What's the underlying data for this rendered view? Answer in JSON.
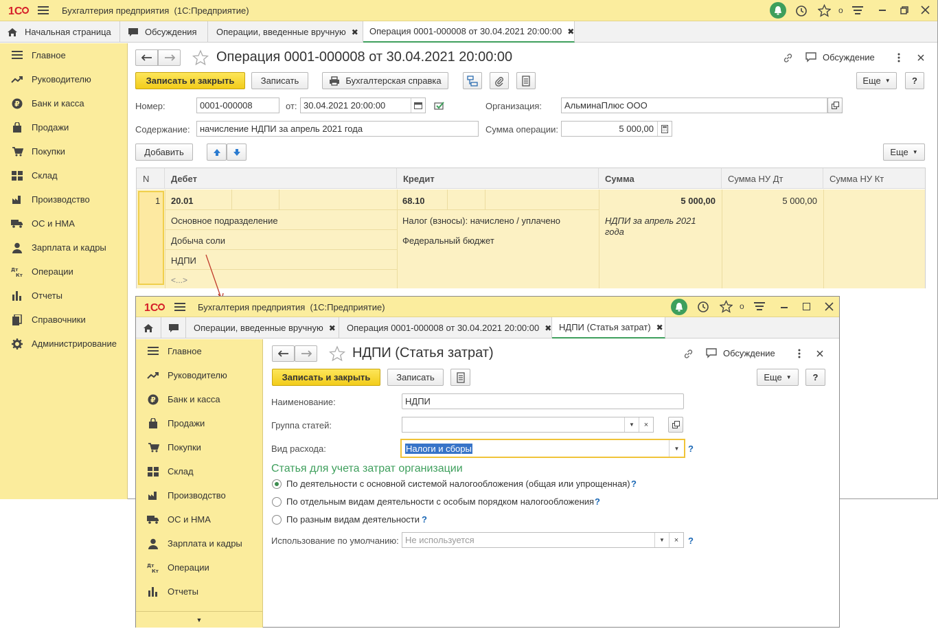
{
  "app_title": "Бухгалтерия предприятия  (1С:Предприятие)",
  "tabs": {
    "home": "Начальная страница",
    "discuss": "Обсуждения",
    "manual_ops": "Операции, введенные вручную",
    "operation": "Операция 0001-000008 от 30.04.2021 20:00:00",
    "ndpi": "НДПИ (Статья затрат)"
  },
  "sidebar": [
    {
      "label": "Главное",
      "icon": "menu-icon"
    },
    {
      "label": "Руководителю",
      "icon": "chart-trend-icon"
    },
    {
      "label": "Банк и касса",
      "icon": "ruble-icon"
    },
    {
      "label": "Продажи",
      "icon": "bag-icon"
    },
    {
      "label": "Покупки",
      "icon": "cart-icon"
    },
    {
      "label": "Склад",
      "icon": "warehouse-icon"
    },
    {
      "label": "Производство",
      "icon": "factory-icon"
    },
    {
      "label": "ОС и НМА",
      "icon": "truck-icon"
    },
    {
      "label": "Зарплата и кадры",
      "icon": "person-icon"
    },
    {
      "label": "Операции",
      "icon": "dtkt-icon"
    },
    {
      "label": "Отчеты",
      "icon": "bar-chart-icon"
    },
    {
      "label": "Справочники",
      "icon": "books-icon"
    },
    {
      "label": "Администрирование",
      "icon": "gear-icon"
    }
  ],
  "operation_form": {
    "title": "Операция 0001-000008 от 30.04.2021 20:00:00",
    "discuss": "Обсуждение",
    "save_close": "Записать и закрыть",
    "save": "Записать",
    "account_ref": "Бухгалтерская справка",
    "more": "Еще",
    "help": "?",
    "number_label": "Номер:",
    "number_value": "0001-000008",
    "date_label": "от:",
    "date_value": "30.04.2021 20:00:00",
    "org_label": "Организация:",
    "org_value": "АльминаПлюс ООО",
    "content_label": "Содержание:",
    "content_value": "начисление НДПИ за апрель 2021 года",
    "sum_label": "Сумма операции:",
    "sum_value": "5 000,00",
    "add": "Добавить",
    "more2": "Еще",
    "table": {
      "headers": {
        "n": "N",
        "debit": "Дебет",
        "credit": "Кредит",
        "sum": "Сумма",
        "sum_nu_dt": "Сумма НУ Дт",
        "sum_nu_kt": "Сумма НУ Кт"
      },
      "row": {
        "n": "1",
        "debit_account": "20.01",
        "debit_sub1": "Основное подразделение",
        "debit_sub2": "Добыча соли",
        "debit_sub3": "НДПИ",
        "debit_sub4": "<...>",
        "credit_account": "68.10",
        "credit_sub1": "Налог (взносы): начислено / уплачено",
        "credit_sub2": "Федеральный бюджет",
        "sum": "5 000,00",
        "sum_comment_1": "НДПИ за апрель 2021",
        "sum_comment_2": "года",
        "sum_nu_dt": "5 000,00"
      }
    }
  },
  "ndpi_form": {
    "title": "НДПИ (Статья затрат)",
    "discuss": "Обсуждение",
    "save_close": "Записать и закрыть",
    "save": "Записать",
    "more": "Еще",
    "help": "?",
    "name_label": "Наименование:",
    "name_value": "НДПИ",
    "group_label": "Группа статей:",
    "group_value": "",
    "expense_label": "Вид расхода:",
    "expense_value": "Налоги и сборы",
    "section_title": "Статья для учета затрат организации",
    "radio1": "По деятельности с основной системой налогообложения (общая или упрощенная)",
    "radio2": "По отдельным видам деятельности с особым порядком налогообложения",
    "radio3": "По разным видам деятельности",
    "radio_selected": 1,
    "default_label": "Использование по умолчанию:",
    "default_placeholder": "Не используется"
  },
  "colors": {
    "accent_yellow": "#fbec9c",
    "green": "#3e9f5c",
    "link_blue": "#1a67b5",
    "red_arrow": "#c0392b"
  }
}
